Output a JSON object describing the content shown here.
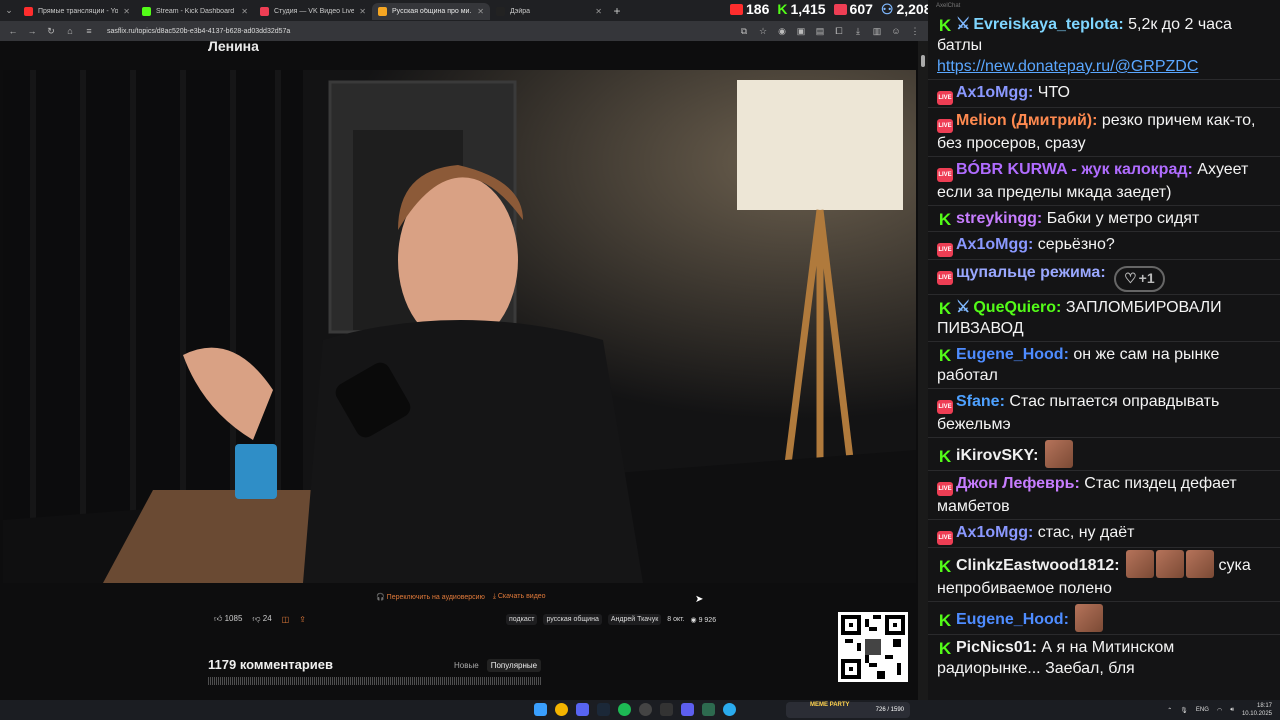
{
  "browser": {
    "tabs": [
      {
        "title": "Прямые трансляции - YouTube",
        "color": "#ff2d2d",
        "active": false
      },
      {
        "title": "Stream - Kick Dashboard",
        "color": "#53fc18",
        "active": false
      },
      {
        "title": "Студия — VK Видео Live",
        "color": "#ee3e54",
        "active": false
      },
      {
        "title": "Русская община про ми...",
        "color": "#f5a623",
        "active": true
      },
      {
        "title": "Дэйра",
        "color": "#222222",
        "active": false
      }
    ],
    "url": "sasflix.ru/topics/d8ac520b-e3b4-4137-b628-ad03dd32d57a"
  },
  "stream_stats": {
    "youtube": "186",
    "kick": "1,415",
    "vk": "607",
    "total": "2,208"
  },
  "page": {
    "title": "Ленина",
    "switch_audio": "Переключить на аудиоверсию",
    "download": "Скачать видео",
    "likes": "1085",
    "dislikes": "24",
    "tags": [
      "подкаст",
      "русская община",
      "Андрей Ткачук"
    ],
    "date": "8 окт.",
    "views": "9 926",
    "comments_title": "1179 комментариев",
    "sort_new": "Новые",
    "sort_popular": "Популярные"
  },
  "taskbar": {
    "widget_label": "MEME PARTY",
    "widget_counter": "726 / 1590",
    "lang": "ENG",
    "time": "18:17",
    "date": "10.10.2025"
  },
  "chat": {
    "header": "AxelChat",
    "messages": [
      {
        "platform": "kick",
        "mod": true,
        "user": "Evreiskaya_teplota",
        "color": "#7fd6ff",
        "text": "5,2к до 2 часа батлы",
        "link": "https://new.donatepay.ru/@GRPZDC"
      },
      {
        "platform": "vk",
        "user": "Ax1oMgg",
        "color": "#8a98ff",
        "text": "ЧТО"
      },
      {
        "platform": "vk",
        "user": "Melion (Дмитрий)",
        "color": "#ff8a50",
        "text": "резко причем как-то, без просеров, сразу"
      },
      {
        "platform": "vk",
        "user": "BÓBR KURWA - жук калокрад",
        "color": "#b06cff",
        "text": "Ахуеет если за пределы мкада заедет)"
      },
      {
        "platform": "kick",
        "user": "streykingg",
        "color": "#c77dff",
        "text": "Бабки у метро сидят"
      },
      {
        "platform": "vk",
        "user": "Ax1oMgg",
        "color": "#8a98ff",
        "text": "серьёзно?"
      },
      {
        "platform": "vk",
        "user": "щупальце режима",
        "color": "#9aa8ff",
        "text": "",
        "heart": "+1"
      },
      {
        "platform": "kick",
        "mod": true,
        "user": "QueQuiero",
        "color": "#53fc18",
        "text": "ЗАПЛОМБИРОВАЛИ ПИВЗАВОД"
      },
      {
        "platform": "kick",
        "user": "Eugene_Hood",
        "color": "#4e8cff",
        "text": "он же сам на рынке работал"
      },
      {
        "platform": "vk",
        "user": "Sfane",
        "color": "#4ea1ff",
        "text": "Стас пытается оправдывать бежельмэ"
      },
      {
        "platform": "kick",
        "user": "iKirovSKY",
        "color": "#f0f0f0",
        "text": "",
        "emotes": 1
      },
      {
        "platform": "vk",
        "user": "Джон Лефеврь",
        "color": "#c77dff",
        "text": "Стас пиздец дефает мамбетов"
      },
      {
        "platform": "vk",
        "user": "Ax1oMgg",
        "color": "#8a98ff",
        "text": "стас, ну даёт"
      },
      {
        "platform": "kick",
        "user": "ClinkzEastwood1812",
        "color": "#f0f0f0",
        "text": "сука непробиваемое полено",
        "emotes": 3
      },
      {
        "platform": "kick",
        "user": "Eugene_Hood",
        "color": "#4e8cff",
        "text": "",
        "emotes": 1
      },
      {
        "platform": "kick",
        "user": "PicNics01",
        "color": "#f0f0f0",
        "text": "А я на Митинском радиорынке... Заебал, бля"
      }
    ]
  }
}
